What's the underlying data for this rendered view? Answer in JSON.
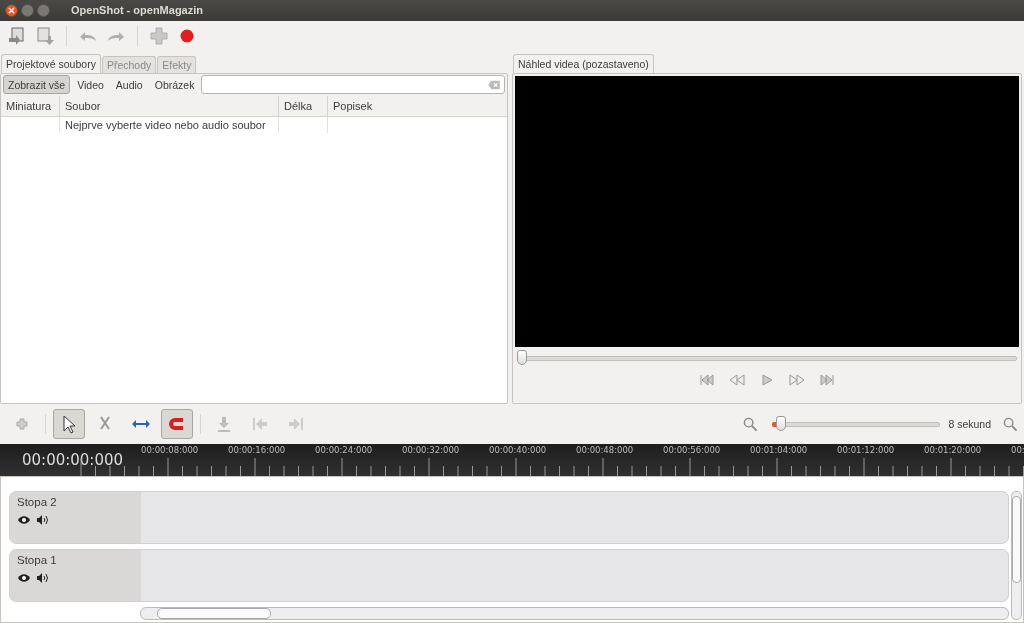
{
  "window": {
    "title": "OpenShot - openMagazin"
  },
  "toolbar": [
    {
      "kind": "import",
      "disabled": false
    },
    {
      "kind": "export",
      "disabled": true
    },
    {
      "kind": "undo",
      "disabled": true
    },
    {
      "kind": "redo",
      "disabled": true
    },
    {
      "kind": "add",
      "disabled": true
    },
    {
      "kind": "record",
      "disabled": false
    }
  ],
  "left_tabs": [
    {
      "label": "Projektové soubory",
      "selected": true
    },
    {
      "label": "Přechody",
      "selected": false
    },
    {
      "label": "Efekty",
      "selected": false
    }
  ],
  "filters": [
    {
      "label": "Zobrazit vše",
      "selected": true
    },
    {
      "label": "Video",
      "selected": false
    },
    {
      "label": "Audio",
      "selected": false
    },
    {
      "label": "Obrázek",
      "selected": false
    }
  ],
  "file_table": {
    "columns": [
      "Miniatura",
      "Soubor",
      "Délka",
      "Popisek"
    ],
    "rows": [
      {
        "file": "Nejprve vyberte video nebo audio soubor"
      }
    ]
  },
  "preview": {
    "tab": {
      "label": "Náhled videa (pozastaveno)",
      "selected": true
    },
    "seek": {
      "level": 0
    }
  },
  "timeline_tools": [
    {
      "kind": "add",
      "selected": false
    },
    {
      "kind": "pointer",
      "selected": true
    },
    {
      "kind": "razor",
      "selected": false
    },
    {
      "kind": "resize",
      "selected": false
    },
    {
      "kind": "snap",
      "selected": true
    },
    {
      "kind": "marker",
      "selected": false
    },
    {
      "kind": "previous",
      "selected": false
    },
    {
      "kind": "next",
      "selected": false
    }
  ],
  "zoom": {
    "level": 0.02,
    "reading": "8 sekund"
  },
  "ruler": {
    "time": "00:00:00:000",
    "labels": [
      "00:00:08:000",
      "00:00:16:000",
      "00:00:24:000",
      "00:00:32:000",
      "00:00:40:000",
      "00:00:48:000",
      "00:00:56:000",
      "00:01:04:000",
      "00:01:12:000",
      "00:01:20:000",
      "00:"
    ]
  },
  "tracks": [
    {
      "name": "Stopa 2"
    },
    {
      "name": "Stopa 1"
    }
  ]
}
